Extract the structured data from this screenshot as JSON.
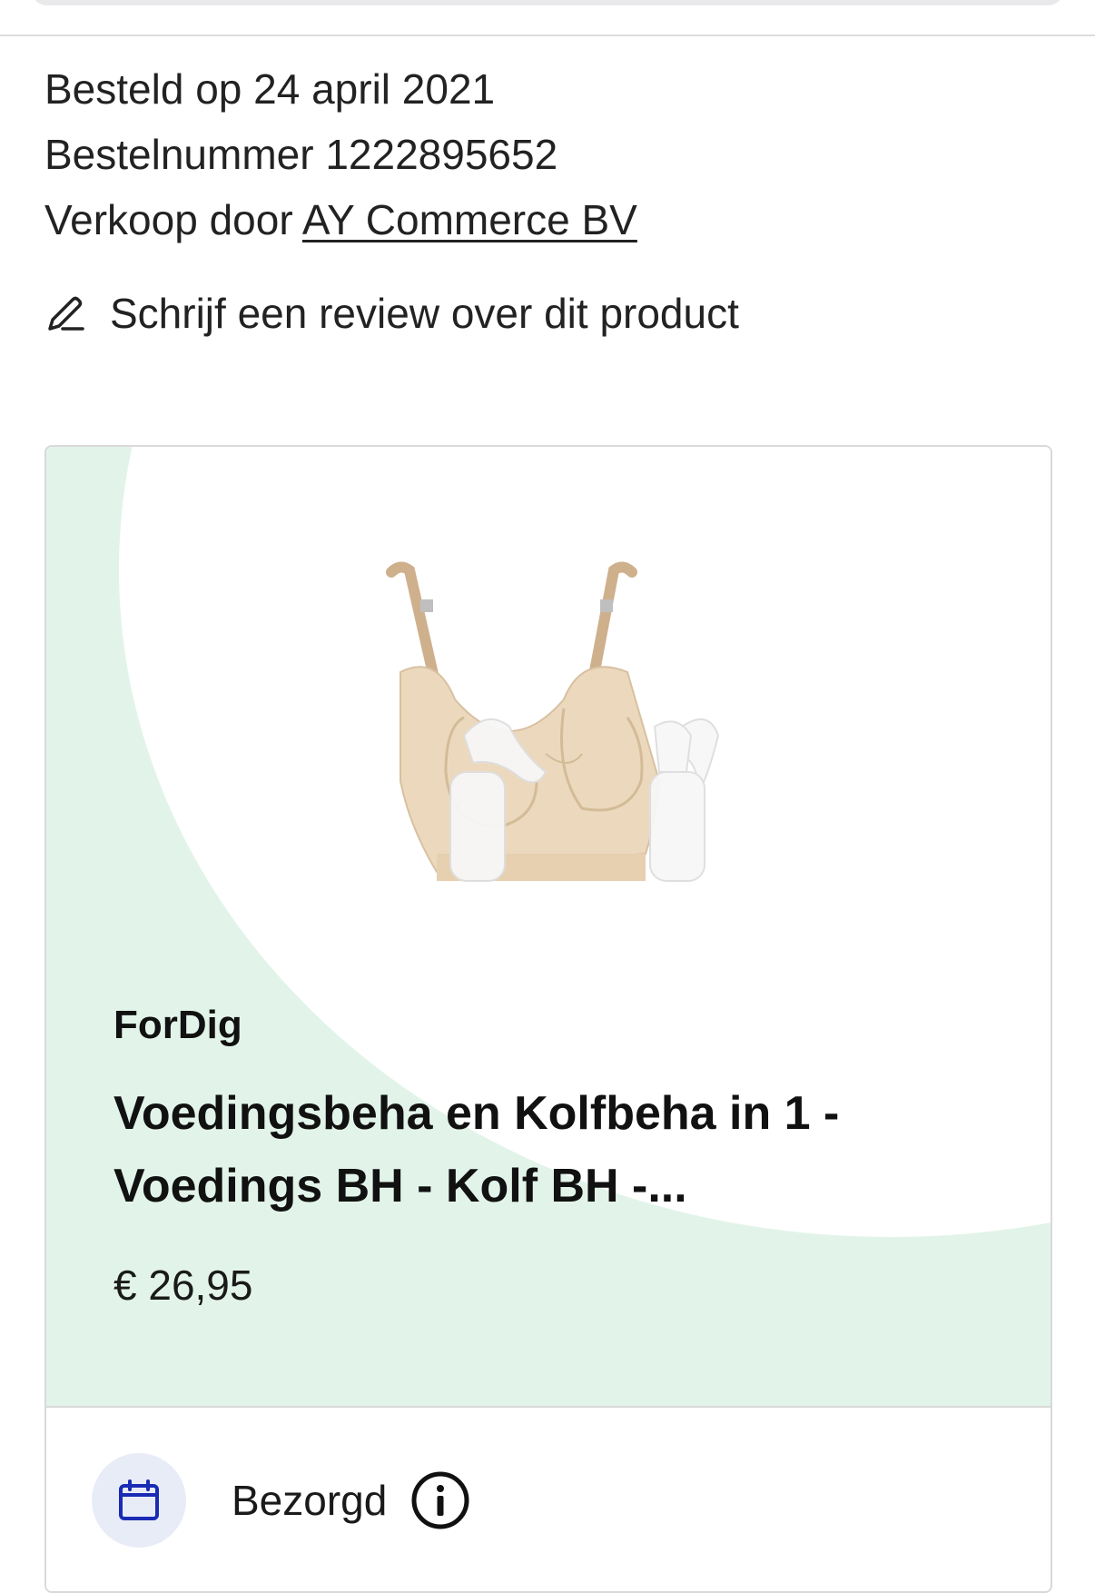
{
  "order": {
    "ordered_on": "Besteld op 24 april 2021",
    "order_number": "Bestelnummer 1222895652",
    "sold_by_prefix": "Verkoop door ",
    "seller_name": "AY Commerce BV"
  },
  "review": {
    "label": "Schrijf een review over dit product",
    "icon": "pencil-icon"
  },
  "product": {
    "brand": "ForDig",
    "title_line1": "Voedingsbeha en Kolfbeha in 1 -",
    "title_line2": "Voedings BH - Kolf BH -...",
    "price": "€ 26,95",
    "image_alt": "nursing bra with pump bottles"
  },
  "delivery": {
    "status": "Bezorgd",
    "status_icon": "calendar-icon",
    "info_icon": "info-icon"
  },
  "colors": {
    "accent_green_bg": "#e2f4e9",
    "calendar_blue": "#1a2bb5",
    "calendar_bg": "#e8ecf7"
  }
}
